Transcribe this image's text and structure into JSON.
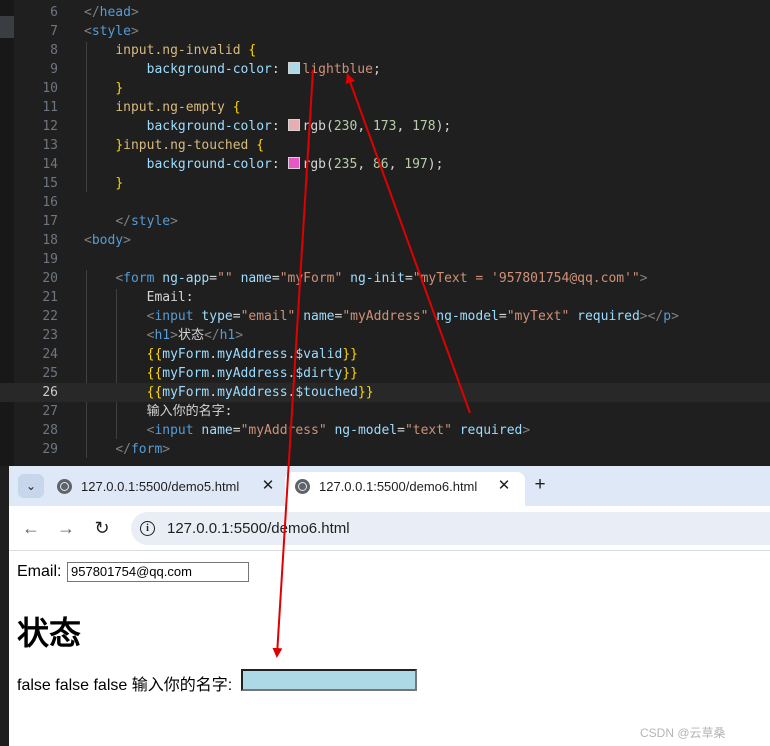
{
  "editor": {
    "lines": [
      {
        "n": "6",
        "tokens": [
          [
            "t-br",
            "</"
          ],
          [
            "t-tag",
            "head"
          ],
          [
            "t-br",
            ">"
          ]
        ]
      },
      {
        "n": "7",
        "tokens": [
          [
            "t-br",
            "<"
          ],
          [
            "t-tag",
            "style"
          ],
          [
            "t-br",
            ">"
          ]
        ]
      },
      {
        "n": "8",
        "tokens": [
          [
            "t-txt",
            "    "
          ],
          [
            "t-sel",
            "input.ng-invalid "
          ],
          [
            "t-brace",
            "{"
          ]
        ]
      },
      {
        "n": "9",
        "tokens": [
          [
            "t-txt",
            "        "
          ],
          [
            "t-prop",
            "background-color"
          ],
          [
            "t-txt",
            ": "
          ],
          [
            "swatch",
            "#add8e6"
          ],
          [
            "t-str",
            "lightblue"
          ],
          [
            "t-txt",
            ";"
          ]
        ]
      },
      {
        "n": "10",
        "tokens": [
          [
            "t-txt",
            "    "
          ],
          [
            "t-brace",
            "}"
          ]
        ]
      },
      {
        "n": "11",
        "tokens": [
          [
            "t-txt",
            "    "
          ],
          [
            "t-sel",
            "input.ng-empty "
          ],
          [
            "t-brace",
            "{"
          ]
        ]
      },
      {
        "n": "12",
        "tokens": [
          [
            "t-txt",
            "        "
          ],
          [
            "t-prop",
            "background-color"
          ],
          [
            "t-txt",
            ": "
          ],
          [
            "swatch",
            "#e6adb2"
          ],
          [
            "t-txt",
            "rgb("
          ],
          [
            "t-num",
            "230"
          ],
          [
            "t-txt",
            ", "
          ],
          [
            "t-num",
            "173"
          ],
          [
            "t-txt",
            ", "
          ],
          [
            "t-num",
            "178"
          ],
          [
            "t-txt",
            ");"
          ]
        ]
      },
      {
        "n": "13",
        "tokens": [
          [
            "t-txt",
            "    "
          ],
          [
            "t-brace",
            "}"
          ],
          [
            "t-sel",
            "input.ng-touched "
          ],
          [
            "t-brace",
            "{"
          ]
        ]
      },
      {
        "n": "14",
        "tokens": [
          [
            "t-txt",
            "        "
          ],
          [
            "t-prop",
            "background-color"
          ],
          [
            "t-txt",
            ": "
          ],
          [
            "swatch",
            "#eb56c5"
          ],
          [
            "t-txt",
            "rgb("
          ],
          [
            "t-num",
            "235"
          ],
          [
            "t-txt",
            ", "
          ],
          [
            "t-num",
            "86"
          ],
          [
            "t-txt",
            ", "
          ],
          [
            "t-num",
            "197"
          ],
          [
            "t-txt",
            ");"
          ]
        ]
      },
      {
        "n": "15",
        "tokens": [
          [
            "t-txt",
            "    "
          ],
          [
            "t-brace",
            "}"
          ]
        ]
      },
      {
        "n": "16",
        "tokens": []
      },
      {
        "n": "17",
        "tokens": [
          [
            "t-txt",
            "    "
          ],
          [
            "t-br",
            "</"
          ],
          [
            "t-tag",
            "style"
          ],
          [
            "t-br",
            ">"
          ]
        ]
      },
      {
        "n": "18",
        "tokens": [
          [
            "t-br",
            "<"
          ],
          [
            "t-tag",
            "body"
          ],
          [
            "t-br",
            ">"
          ]
        ]
      },
      {
        "n": "19",
        "tokens": []
      },
      {
        "n": "20",
        "tokens": [
          [
            "t-txt",
            "    "
          ],
          [
            "t-br",
            "<"
          ],
          [
            "t-tag",
            "form "
          ],
          [
            "t-attr",
            "ng-app"
          ],
          [
            "t-txt",
            "="
          ],
          [
            "t-str",
            "\"\""
          ],
          [
            "t-txt",
            " "
          ],
          [
            "t-attr",
            "name"
          ],
          [
            "t-txt",
            "="
          ],
          [
            "t-str",
            "\"myForm\""
          ],
          [
            "t-txt",
            " "
          ],
          [
            "t-attr",
            "ng-init"
          ],
          [
            "t-txt",
            "="
          ],
          [
            "t-str",
            "\"myText = '957801754@qq.com'\""
          ],
          [
            "t-br",
            ">"
          ]
        ]
      },
      {
        "n": "21",
        "tokens": [
          [
            "t-txt",
            "        Email:"
          ]
        ]
      },
      {
        "n": "22",
        "tokens": [
          [
            "t-txt",
            "        "
          ],
          [
            "t-br",
            "<"
          ],
          [
            "t-tag",
            "input "
          ],
          [
            "t-attr",
            "type"
          ],
          [
            "t-txt",
            "="
          ],
          [
            "t-str",
            "\"email\""
          ],
          [
            "t-txt",
            " "
          ],
          [
            "t-attr",
            "name"
          ],
          [
            "t-txt",
            "="
          ],
          [
            "t-str",
            "\"myAddress\""
          ],
          [
            "t-txt",
            " "
          ],
          [
            "t-attr",
            "ng-model"
          ],
          [
            "t-txt",
            "="
          ],
          [
            "t-str",
            "\"myText\""
          ],
          [
            "t-txt",
            " "
          ],
          [
            "t-attr",
            "required"
          ],
          [
            "t-br",
            "></"
          ],
          [
            "t-tag",
            "p"
          ],
          [
            "t-br",
            ">"
          ]
        ]
      },
      {
        "n": "23",
        "tokens": [
          [
            "t-txt",
            "        "
          ],
          [
            "t-br",
            "<"
          ],
          [
            "t-tag",
            "h1"
          ],
          [
            "t-br",
            ">"
          ],
          [
            "t-txt",
            "状态"
          ],
          [
            "t-br",
            "</"
          ],
          [
            "t-tag",
            "h1"
          ],
          [
            "t-br",
            ">"
          ]
        ]
      },
      {
        "n": "24",
        "tokens": [
          [
            "t-txt",
            "        "
          ],
          [
            "t-brace",
            "{{"
          ],
          [
            "t-attr",
            "myForm"
          ],
          [
            "t-txt",
            "."
          ],
          [
            "t-attr",
            "myAddress"
          ],
          [
            "t-txt",
            "."
          ],
          [
            "t-attr",
            "$valid"
          ],
          [
            "t-brace",
            "}}"
          ]
        ]
      },
      {
        "n": "25",
        "tokens": [
          [
            "t-txt",
            "        "
          ],
          [
            "t-brace",
            "{{"
          ],
          [
            "t-attr",
            "myForm"
          ],
          [
            "t-txt",
            "."
          ],
          [
            "t-attr",
            "myAddress"
          ],
          [
            "t-txt",
            "."
          ],
          [
            "t-attr",
            "$dirty"
          ],
          [
            "t-brace",
            "}}"
          ]
        ]
      },
      {
        "n": "26",
        "tokens": [
          [
            "t-txt",
            "        "
          ],
          [
            "t-brace",
            "{{"
          ],
          [
            "t-attr",
            "myForm"
          ],
          [
            "t-txt",
            "."
          ],
          [
            "t-attr",
            "myAddress"
          ],
          [
            "t-txt",
            "."
          ],
          [
            "t-attr",
            "$touched"
          ],
          [
            "t-brace",
            "}}"
          ]
        ],
        "active": true
      },
      {
        "n": "27",
        "tokens": [
          [
            "t-txt",
            "        输入你的名字:"
          ]
        ]
      },
      {
        "n": "28",
        "tokens": [
          [
            "t-txt",
            "        "
          ],
          [
            "t-br",
            "<"
          ],
          [
            "t-tag",
            "input "
          ],
          [
            "t-attr",
            "name"
          ],
          [
            "t-txt",
            "="
          ],
          [
            "t-str",
            "\"myAddress\""
          ],
          [
            "t-txt",
            " "
          ],
          [
            "t-attr",
            "ng-model"
          ],
          [
            "t-txt",
            "="
          ],
          [
            "t-str",
            "\"text\""
          ],
          [
            "t-txt",
            " "
          ],
          [
            "t-attr",
            "required"
          ],
          [
            "t-br",
            ">"
          ]
        ]
      },
      {
        "n": "29",
        "tokens": [
          [
            "t-txt",
            "    "
          ],
          [
            "t-br",
            "</"
          ],
          [
            "t-tag",
            "form"
          ],
          [
            "t-br",
            ">"
          ]
        ]
      }
    ]
  },
  "browser": {
    "tabs": [
      {
        "title": "127.0.0.1:5500/demo5.html",
        "close": "✕"
      },
      {
        "title": "127.0.0.1:5500/demo6.html",
        "close": "✕"
      }
    ],
    "tab_menu_icon": "⌄",
    "new_tab": "+",
    "back_icon": "←",
    "forward_icon": "→",
    "reload_icon": "↻",
    "info_icon": "i",
    "url": "127.0.0.1:5500/demo6.html"
  },
  "page": {
    "email_label": "Email:",
    "email_value": "957801754@qq.com",
    "heading": "状态",
    "status_text": "false false false 输入你的名字:",
    "name_value": "",
    "name_input_color": "#add8e6"
  },
  "watermark": "CSDN @云草桑",
  "annotation_color": "#e00000"
}
